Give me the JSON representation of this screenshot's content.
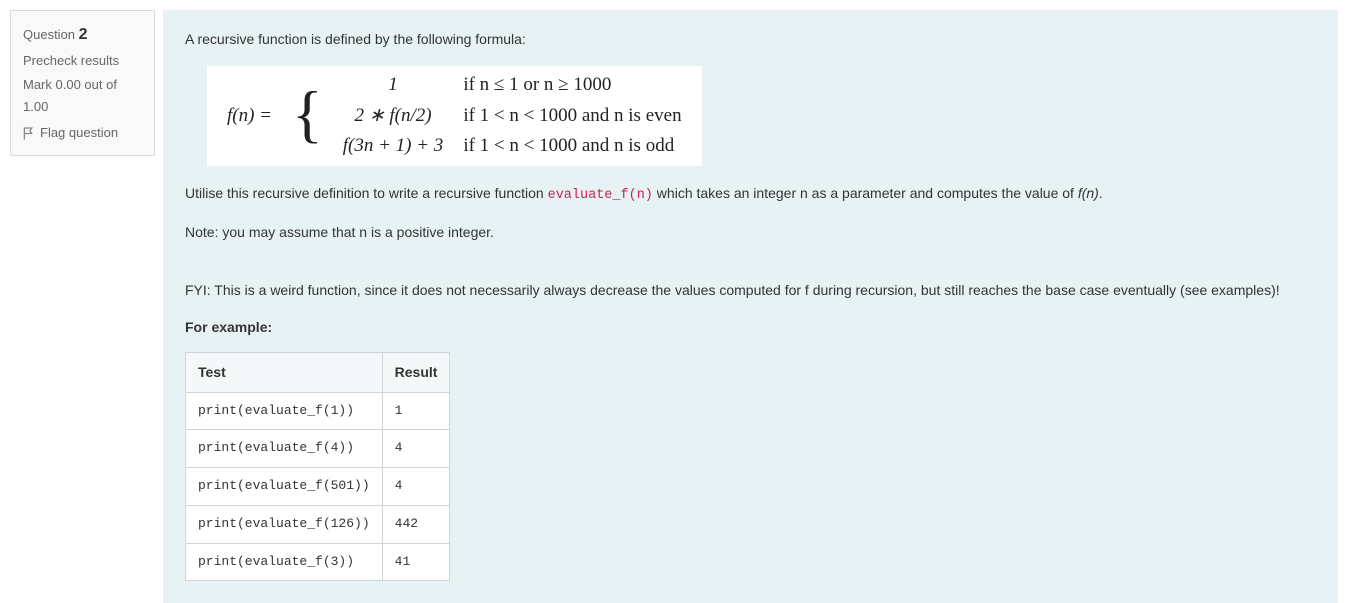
{
  "info": {
    "question_label": "Question",
    "question_number": "2",
    "precheck": "Precheck results",
    "mark_line": "Mark 0.00 out of 1.00",
    "flag_label": "Flag question"
  },
  "content": {
    "intro": "A recursive function is defined by the following formula:",
    "formula": {
      "lhs": "f(n) =",
      "rows": [
        {
          "value": "1",
          "cond": "if n ≤ 1 or n ≥ 1000"
        },
        {
          "value": "2 ∗ f(n/2)",
          "cond": "if 1 < n < 1000 and n is even"
        },
        {
          "value": "f(3n + 1) + 3",
          "cond": "if 1 < n < 1000 and n is odd"
        }
      ]
    },
    "instruction_pre": "Utilise this recursive definition to write a recursive function ",
    "instruction_code": "evaluate_f(n)",
    "instruction_post": " which takes an integer n as a parameter and computes the value of ",
    "instruction_fn": "f(n)",
    "instruction_end": ".",
    "note": "Note: you may assume that n is a positive integer.",
    "fyi": "FYI: This is a weird function, since it does not necessarily always decrease the values computed for f during recursion, but still reaches the base case eventually (see examples)!",
    "for_example": "For example:",
    "table": {
      "headers": [
        "Test",
        "Result"
      ],
      "rows": [
        {
          "test": "print(evaluate_f(1))",
          "result": "1"
        },
        {
          "test": "print(evaluate_f(4))",
          "result": "4"
        },
        {
          "test": "print(evaluate_f(501))",
          "result": "4"
        },
        {
          "test": "print(evaluate_f(126))",
          "result": "442"
        },
        {
          "test": "print(evaluate_f(3))",
          "result": "41"
        }
      ]
    }
  }
}
